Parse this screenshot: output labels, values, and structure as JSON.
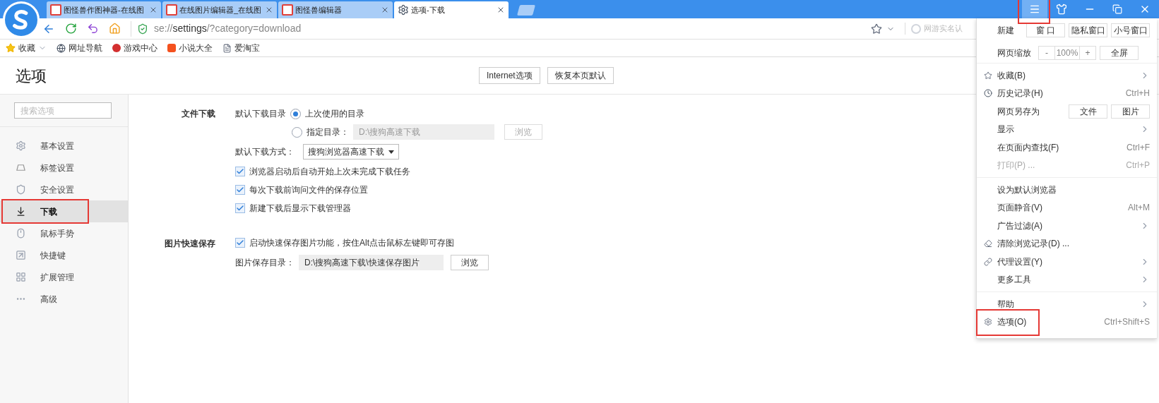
{
  "tabs": [
    {
      "label": "图怪兽作图神器-在线图",
      "selected": false
    },
    {
      "label": "在线图片编辑器_在线图",
      "selected": false
    },
    {
      "label": "图怪兽编辑器",
      "selected": false
    },
    {
      "label": "选项-下载",
      "selected": true
    }
  ],
  "window_controls": {
    "menu_highlighted": true
  },
  "address_bar": {
    "url": "se://**settings**/?category=download",
    "extension_text": "网游实名认"
  },
  "bookmarks": [
    "收藏",
    "网址导航",
    "游戏中心",
    "小说大全",
    "爱淘宝"
  ],
  "page": {
    "title": "选项",
    "buttons": [
      "Internet选项",
      "恢复本页默认"
    ]
  },
  "sidebar": {
    "search": {
      "placeholder": "搜索选项"
    },
    "items": [
      {
        "label": "基本设置",
        "selected": false,
        "highlighted": false
      },
      {
        "label": "标签设置",
        "selected": false,
        "highlighted": false
      },
      {
        "label": "安全设置",
        "selected": false,
        "highlighted": false
      },
      {
        "label": "下载",
        "selected": true,
        "highlighted": true
      },
      {
        "label": "鼠标手势",
        "selected": false,
        "highlighted": false
      },
      {
        "label": "快捷键",
        "selected": false,
        "highlighted": false
      },
      {
        "label": "扩展管理",
        "selected": false,
        "highlighted": false
      },
      {
        "label": "高级",
        "selected": false,
        "highlighted": false
      }
    ]
  },
  "file_download": {
    "title": "文件下载",
    "dir_label": "默认下载目录",
    "dir_options": [
      {
        "label": "上次使用的目录",
        "selected": true
      },
      {
        "label": "指定目录：",
        "selected": false,
        "path": "D:\\搜狗高速下载",
        "button": "浏览"
      }
    ],
    "method_label": "默认下载方式：",
    "method_value": "搜狗浏览器高速下载",
    "checkboxes": [
      {
        "label": "浏览器启动后自动开始上次未完成下载任务",
        "checked": true
      },
      {
        "label": "每次下载前询问文件的保存位置",
        "checked": true
      },
      {
        "label": "新建下载后显示下载管理器",
        "checked": true
      }
    ]
  },
  "quick_save": {
    "title": "图片快速保存",
    "checkbox": {
      "label": "启动快速保存图片功能，按住Alt点击鼠标左键即可存图",
      "checked": true
    },
    "dir_label": "图片保存目录：",
    "path": "D:\\搜狗高速下载\\快速保存图片",
    "button": "浏览"
  },
  "menu": {
    "new_label": "新建",
    "new_buttons": [
      "窗 口",
      "隐私窗口",
      "小号窗口"
    ],
    "zoom_label": "网页缩放",
    "zoom_minus": "-",
    "zoom_value": "100%",
    "zoom_plus": "+",
    "fullscreen": "全屏",
    "groups": [
      [
        {
          "kind": "submenu",
          "label": "收藏(B)",
          "disabled": false,
          "highlighted": false
        },
        {
          "kind": "shortcut",
          "label": "历史记录(H)",
          "shortcut": "Ctrl+H",
          "disabled": false,
          "highlighted": false
        },
        {
          "kind": "buttons",
          "label": "网页另存为",
          "buttons": [
            "文件",
            "图片"
          ],
          "disabled": false,
          "highlighted": false
        },
        {
          "kind": "submenu",
          "label": "显示",
          "disabled": false,
          "highlighted": false
        },
        {
          "kind": "shortcut",
          "label": "在页面内查找(F)",
          "shortcut": "Ctrl+F",
          "disabled": false,
          "highlighted": false
        },
        {
          "kind": "shortcut",
          "label": "打印(P) ...",
          "shortcut": "Ctrl+P",
          "disabled": true,
          "highlighted": false
        }
      ],
      [
        {
          "kind": "plain",
          "label": "设为默认浏览器",
          "disabled": false,
          "highlighted": false
        },
        {
          "kind": "shortcut",
          "label": "页面静音(V)",
          "shortcut": "Alt+M",
          "disabled": false,
          "highlighted": false
        },
        {
          "kind": "submenu",
          "label": "广告过滤(A)",
          "disabled": false,
          "highlighted": false
        },
        {
          "kind": "plain",
          "label": "清除浏览记录(D) ...",
          "disabled": false,
          "highlighted": false
        },
        {
          "kind": "submenu",
          "label": "代理设置(Y)",
          "disabled": false,
          "highlighted": false
        },
        {
          "kind": "submenu",
          "label": "更多工具",
          "disabled": false,
          "highlighted": false
        }
      ],
      [
        {
          "kind": "submenu",
          "label": "帮助",
          "disabled": false,
          "highlighted": false
        },
        {
          "kind": "shortcut",
          "label": "选项(O)",
          "shortcut": "Ctrl+Shift+S",
          "disabled": false,
          "highlighted": true
        }
      ]
    ]
  }
}
